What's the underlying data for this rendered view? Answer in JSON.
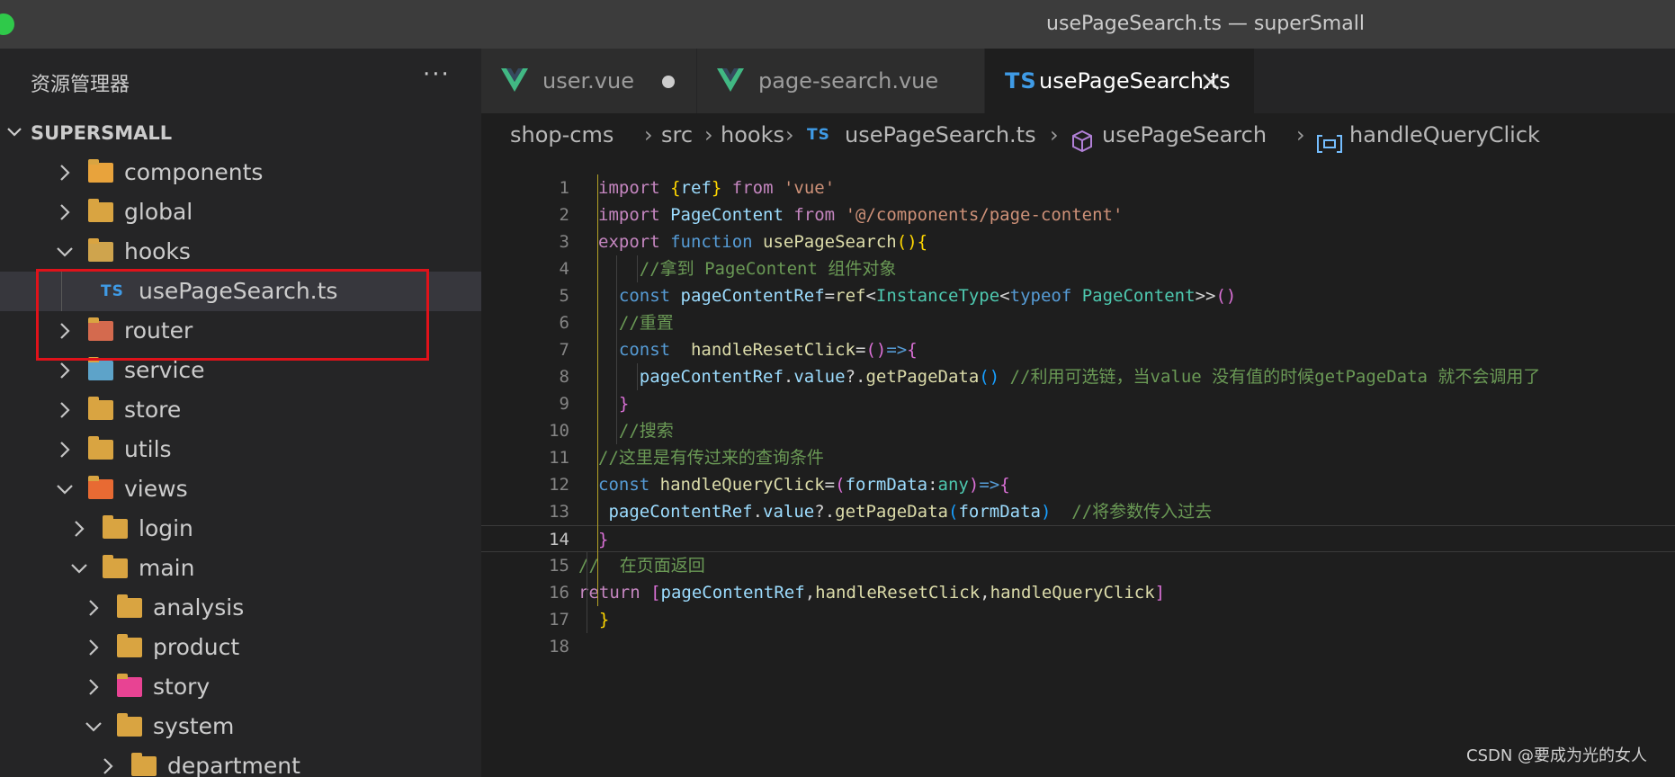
{
  "window": {
    "title": "usePageSearch.ts — superSmall"
  },
  "sidebar": {
    "title": "资源管理器",
    "more": "···",
    "section": "SUPERSMALL",
    "tree": [
      {
        "label": "components",
        "depth": 1,
        "expanded": false,
        "icon": "components-folder-icon"
      },
      {
        "label": "global",
        "depth": 1,
        "expanded": false,
        "icon": "folder-icon"
      },
      {
        "label": "hooks",
        "depth": 1,
        "expanded": true,
        "icon": "hooks-folder-icon"
      },
      {
        "label": "usePageSearch.ts",
        "depth": 2,
        "file": true,
        "icon": "typescript-file-icon",
        "badge": "TS",
        "selected": true
      },
      {
        "label": "router",
        "depth": 1,
        "expanded": false,
        "icon": "router-folder-icon"
      },
      {
        "label": "service",
        "depth": 1,
        "expanded": false,
        "icon": "service-folder-icon"
      },
      {
        "label": "store",
        "depth": 1,
        "expanded": false,
        "icon": "folder-icon"
      },
      {
        "label": "utils",
        "depth": 1,
        "expanded": false,
        "icon": "utils-folder-icon"
      },
      {
        "label": "views",
        "depth": 1,
        "expanded": true,
        "icon": "views-folder-icon"
      },
      {
        "label": "login",
        "depth": 2,
        "expanded": false,
        "icon": "folder-icon"
      },
      {
        "label": "main",
        "depth": 2,
        "expanded": true,
        "icon": "folder-icon"
      },
      {
        "label": "analysis",
        "depth": 3,
        "expanded": false,
        "icon": "folder-icon"
      },
      {
        "label": "product",
        "depth": 3,
        "expanded": false,
        "icon": "folder-icon"
      },
      {
        "label": "story",
        "depth": 3,
        "expanded": false,
        "icon": "story-folder-icon"
      },
      {
        "label": "system",
        "depth": 3,
        "expanded": true,
        "icon": "folder-icon"
      },
      {
        "label": "department",
        "depth": 4,
        "expanded": false,
        "icon": "folder-icon"
      }
    ]
  },
  "tabs": [
    {
      "label": "user.vue",
      "icon": "vue-icon",
      "dirty": true
    },
    {
      "label": "page-search.vue",
      "icon": "vue-icon"
    },
    {
      "label": "usePageSearch.ts",
      "icon": "typescript-file-icon",
      "badge": "TS",
      "active": true
    }
  ],
  "breadcrumb": {
    "items": [
      "shop-cms",
      "src",
      "hooks",
      "usePageSearch.ts",
      "usePageSearch",
      "handleQueryClick"
    ],
    "ts_badge": "TS"
  },
  "editor": {
    "current_line": 14,
    "lines": [
      {
        "n": "1",
        "tokens": [
          [
            "k",
            "import "
          ],
          [
            "br1",
            "{"
          ],
          [
            "v",
            "ref"
          ],
          [
            "br1",
            "}"
          ],
          [
            "k",
            " from "
          ],
          [
            "s",
            "'vue'"
          ]
        ]
      },
      {
        "n": "2",
        "tokens": [
          [
            "k",
            "import "
          ],
          [
            "v",
            "PageContent"
          ],
          [
            "k",
            " from "
          ],
          [
            "s",
            "'@/components/page-content'"
          ]
        ]
      },
      {
        "n": "3",
        "tokens": [
          [
            "k",
            "export "
          ],
          [
            "kb",
            "function "
          ],
          [
            "f",
            "usePageSearch"
          ],
          [
            "br1",
            "()"
          ],
          [
            "br1",
            "{"
          ]
        ]
      },
      {
        "n": "4",
        "tokens": [
          [
            "c",
            "    //拿到 PageContent 组件对象"
          ]
        ]
      },
      {
        "n": "5",
        "tokens": [
          [
            "kb",
            "  const "
          ],
          [
            "v",
            "pageContentRef"
          ],
          [
            "p",
            "="
          ],
          [
            "f",
            "ref"
          ],
          [
            "p",
            "<"
          ],
          [
            "t",
            "InstanceType"
          ],
          [
            "p",
            "<"
          ],
          [
            "kb",
            "typeof "
          ],
          [
            "t",
            "PageContent"
          ],
          [
            "p",
            ">>"
          ],
          [
            "br2",
            "()"
          ]
        ]
      },
      {
        "n": "6",
        "tokens": [
          [
            "c",
            "  //重置"
          ]
        ]
      },
      {
        "n": "7",
        "tokens": [
          [
            "kb",
            "  const  "
          ],
          [
            "f",
            "handleResetClick"
          ],
          [
            "p",
            "="
          ],
          [
            "br2",
            "()"
          ],
          [
            "kb",
            "=>"
          ],
          [
            "br2",
            "{"
          ]
        ]
      },
      {
        "n": "8",
        "tokens": [
          [
            "v",
            "    pageContentRef"
          ],
          [
            "p",
            "."
          ],
          [
            "v",
            "value"
          ],
          [
            "p",
            "?."
          ],
          [
            "f",
            "getPageData"
          ],
          [
            "br3",
            "()"
          ],
          [
            "c",
            " //利用可选链，当value 没有值的时候getPageData 就不会调用了"
          ]
        ]
      },
      {
        "n": "9",
        "tokens": [
          [
            "br2",
            "  }"
          ]
        ]
      },
      {
        "n": "10",
        "tokens": [
          [
            "c",
            "  //搜索"
          ]
        ]
      },
      {
        "n": "11",
        "tokens": [
          [
            "c",
            "//这里是有传过来的查询条件"
          ]
        ]
      },
      {
        "n": "12",
        "tokens": [
          [
            "kb",
            "const "
          ],
          [
            "f",
            "handleQueryClick"
          ],
          [
            "p",
            "="
          ],
          [
            "br2",
            "("
          ],
          [
            "v",
            "formData"
          ],
          [
            "p",
            ":"
          ],
          [
            "t",
            "any"
          ],
          [
            "br2",
            ")"
          ],
          [
            "kb",
            "=>"
          ],
          [
            "br2",
            "{"
          ]
        ]
      },
      {
        "n": "13",
        "tokens": [
          [
            "v",
            " pageContentRef"
          ],
          [
            "p",
            "."
          ],
          [
            "v",
            "value"
          ],
          [
            "p",
            "?."
          ],
          [
            "f",
            "getPageData"
          ],
          [
            "br3",
            "("
          ],
          [
            "v",
            "formData"
          ],
          [
            "br3",
            ")"
          ],
          [
            "c",
            "  //将参数传入过去"
          ]
        ]
      },
      {
        "n": "14",
        "tokens": [
          [
            "br2",
            "}"
          ]
        ]
      },
      {
        "n": "15",
        "tokens": [
          [
            "c",
            "//  在页面返回"
          ]
        ]
      },
      {
        "n": "16",
        "tokens": [
          [
            "k",
            "return "
          ],
          [
            "br2",
            "["
          ],
          [
            "v",
            "pageContentRef"
          ],
          [
            "p",
            ","
          ],
          [
            "f",
            "handleResetClick"
          ],
          [
            "p",
            ","
          ],
          [
            "f",
            "handleQueryClick"
          ],
          [
            "br2",
            "]"
          ]
        ]
      },
      {
        "n": "17",
        "tokens": [
          [
            "br1",
            "  }"
          ]
        ]
      },
      {
        "n": "18",
        "tokens": []
      }
    ]
  },
  "watermark": "CSDN @要成为光的女人",
  "colors": {
    "accent_red": "#e0121a",
    "ts_blue": "#3f9be6",
    "vue_green": "#41b883",
    "folder": "#d9a441"
  }
}
